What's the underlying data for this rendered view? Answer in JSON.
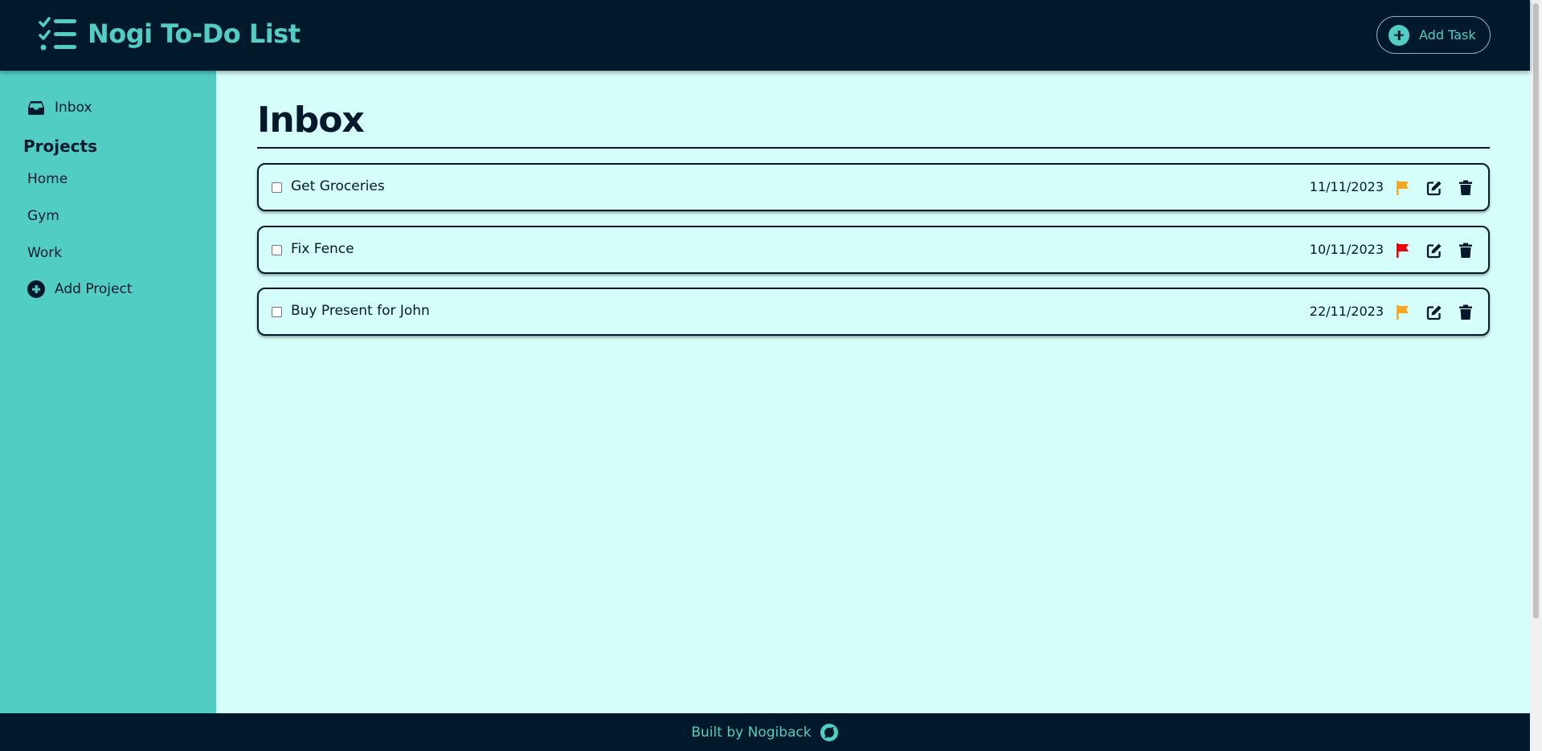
{
  "app": {
    "title": "Nogi To-Do List",
    "logo_icon": "checklist-icon",
    "add_task_label": "Add Task"
  },
  "sidebar": {
    "inbox_label": "Inbox",
    "projects_heading": "Projects",
    "projects": [
      {
        "label": "Home"
      },
      {
        "label": "Gym"
      },
      {
        "label": "Work"
      }
    ],
    "add_project_label": "Add Project"
  },
  "main": {
    "title": "Inbox",
    "tasks": [
      {
        "name": "Get Groceries",
        "date": "11/11/2023",
        "checked": false,
        "priority_color": "#f5a623"
      },
      {
        "name": "Fix Fence",
        "date": "10/11/2023",
        "checked": false,
        "priority_color": "#e8000b"
      },
      {
        "name": "Buy Present for John",
        "date": "22/11/2023",
        "checked": false,
        "priority_color": "#f5a623"
      }
    ]
  },
  "footer": {
    "text": "Built by Nogiback",
    "icon": "github-icon"
  },
  "colors": {
    "header_bg": "#001a2c",
    "accent": "#52cdc4",
    "main_bg": "#d5fdf9",
    "priority_medium": "#f5a623",
    "priority_high": "#e8000b"
  }
}
